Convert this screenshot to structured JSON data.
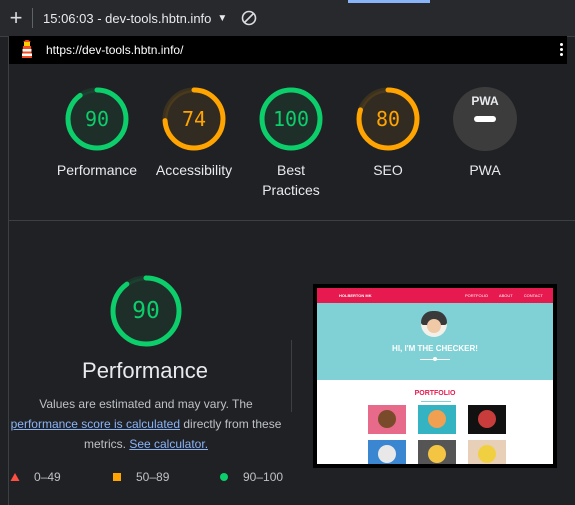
{
  "toolbar": {
    "add_icon": "plus-icon",
    "report_label": "15:06:03 - dev-tools.hbtn.info",
    "dropdown_icon": "caret-down-icon",
    "clear_icon": "block-icon"
  },
  "urlbar": {
    "favicon": "lighthouse-icon",
    "url": "https://dev-tools.hbtn.info/",
    "menu_icon": "more-vert-icon"
  },
  "colors": {
    "pass": "#0cce6b",
    "average": "#ffa400",
    "fail": "#ff4e42",
    "pwa": "#ffffff"
  },
  "gauges": [
    {
      "label": "Performance",
      "score": "90",
      "value": 90,
      "color": "#0cce6b"
    },
    {
      "label": "Accessibility",
      "score": "74",
      "value": 74,
      "color": "#ffa400"
    },
    {
      "label": "Best Practices",
      "score": "100",
      "value": 100,
      "color": "#0cce6b"
    },
    {
      "label": "SEO",
      "score": "80",
      "value": 80,
      "color": "#ffa400"
    },
    {
      "label": "PWA",
      "badge": "PWA",
      "color": "#ffffff"
    }
  ],
  "performance": {
    "score": "90",
    "value": 90,
    "title": "Performance",
    "desc_1": "Values are estimated and may vary. The",
    "desc_link_1": "performance score is calculated",
    "desc_2": "directly from these metrics.",
    "desc_link_2": "See calculator."
  },
  "legend": [
    {
      "range": "0–49",
      "shape": "triangle",
      "color": "#ff4e42"
    },
    {
      "range": "50–89",
      "shape": "square",
      "color": "#ffa400"
    },
    {
      "range": "90–100",
      "shape": "circle",
      "color": "#0cce6b"
    }
  ],
  "thumbnail": {
    "brand": "HOLBERTON MK",
    "nav_links": "PORTFOLIO ABOUT CONTACT",
    "hero_text": "HI, I'M THE CHECKER!",
    "section_title": "PORTFOLIO",
    "tile_colors": [
      "#e86a8a",
      "#34b3c3",
      "#111111",
      "#3a86d1",
      "#555555",
      "#e8d0b8"
    ]
  }
}
